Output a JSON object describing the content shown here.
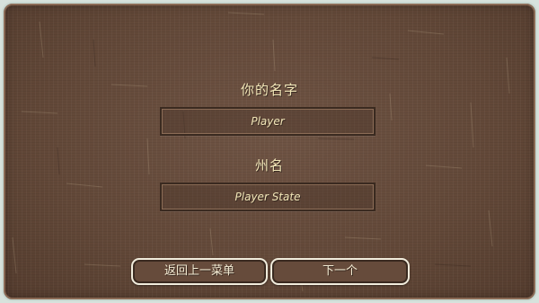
{
  "form": {
    "name_label": "你的名字",
    "name_value": "Player",
    "state_label": "州名",
    "state_value": "Player State"
  },
  "buttons": {
    "back_label": "返回上一菜单",
    "next_label": "下一个"
  },
  "colors": {
    "panel_brown": "#624838",
    "text_cream": "#f2e6b8",
    "border_light": "#f1ecdc"
  }
}
